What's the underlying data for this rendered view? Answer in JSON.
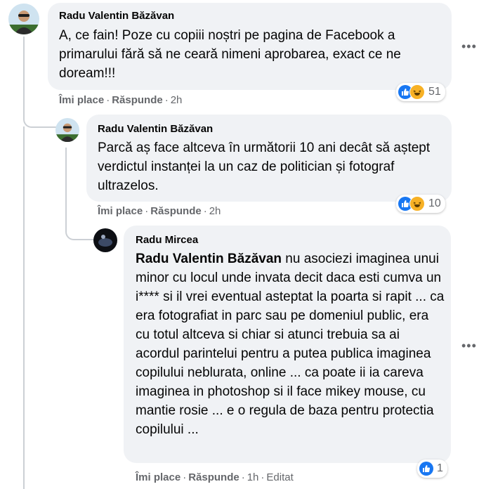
{
  "comments": [
    {
      "author": "Radu Valentin Băzăvan",
      "text": "A, ce fain! Poze cu copiii noștri pe pagina de Facebook a primarului fără să ne ceară nimeni aprobarea, exact ce ne doream!!!",
      "like_label": "Îmi place",
      "reply_label": "Răspunde",
      "time": "2h",
      "reaction_count": "51"
    },
    {
      "author": "Radu Valentin Băzăvan",
      "text": "Parcă aș face altceva în următorii 10 ani decât să aștept verdictul instanței la un caz de politician și fotograf ultrazelos.",
      "like_label": "Îmi place",
      "reply_label": "Răspunde",
      "time": "2h",
      "reaction_count": "10"
    },
    {
      "author": "Radu Mircea",
      "mention": "Radu Valentin Băzăvan",
      "text": " nu asociezi imaginea unui minor cu locul unde invata decit daca esti cumva un i**** si il vrei eventual asteptat la poarta si rapit ... ca era fotografiat in parc sau pe domeniul public, era cu totul altceva si chiar si atunci trebuia sa ai acordul parintelui pentru a putea publica imaginea copilului neblurata, online ... ca poate ii ia careva imaginea in photoshop si il face mikey mouse, cu mantie rosie ... e o regula de baza pentru protectia copilului ...",
      "like_label": "Îmi place",
      "reply_label": "Răspunde",
      "time": "1h",
      "edited_label": "Editat",
      "reaction_count": "1"
    }
  ],
  "separator": "·",
  "more_label": "•••",
  "colors": {
    "bubble": "#f0f2f5",
    "meta_text": "#65676b",
    "like_blue": "#1877f2",
    "haha_yellow": "#f7b125"
  },
  "icons": [
    "avatar-radu-valentin",
    "avatar-radu-mircea",
    "like-reaction-icon",
    "haha-reaction-icon",
    "more-options-icon"
  ]
}
